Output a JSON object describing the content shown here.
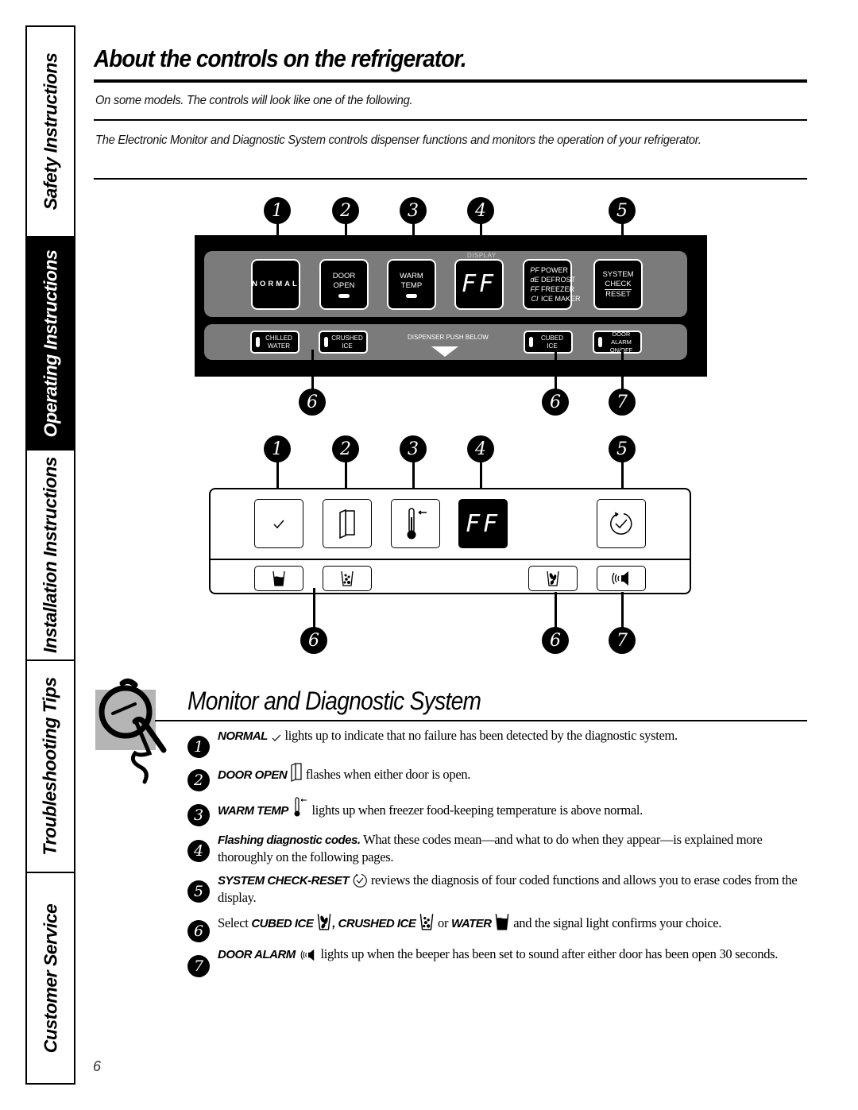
{
  "side_tabs": [
    {
      "label": "Safety Instructions",
      "active": false
    },
    {
      "label": "Operating Instructions",
      "active": true
    },
    {
      "label": "Installation Instructions",
      "active": false
    },
    {
      "label": "Troubleshooting Tips",
      "active": false
    },
    {
      "label": "Customer Service",
      "active": false
    }
  ],
  "header": {
    "title": "About the controls on the refrigerator.",
    "note": "On some models. The controls will look like one of the following.",
    "intro": "The Electronic Monitor and Diagnostic System controls dispenser functions and monitors the operation of your refrigerator."
  },
  "callouts": {
    "top": [
      "1",
      "2",
      "3",
      "4",
      "5"
    ],
    "bottom": [
      "6",
      "6",
      "7"
    ]
  },
  "panel1": {
    "normal": "NORMAL",
    "door_open": [
      "DOOR",
      "OPEN"
    ],
    "warm_temp": [
      "WARM",
      "TEMP"
    ],
    "display_label": "DISPLAY",
    "display_value": "FF",
    "codes": [
      {
        "code": "PF",
        "label": "POWER"
      },
      {
        "code": "dE",
        "label": "DEFROST"
      },
      {
        "code": "FF",
        "label": "FREEZER"
      },
      {
        "code": "CI",
        "label": "ICE MAKER"
      }
    ],
    "system_check": [
      "SYSTEM",
      "CHECK",
      "RESET"
    ],
    "chilled_water": [
      "CHILLED",
      "WATER"
    ],
    "crushed_ice": [
      "CRUSHED",
      "ICE"
    ],
    "dispenser_label": "DISPENSER PUSH BELOW",
    "cubed_ice": [
      "CUBED",
      "ICE"
    ],
    "door_alarm": [
      "DOOR ALARM",
      "ON/OFF"
    ]
  },
  "panel2": {
    "display_value": "FF",
    "icons": [
      "check-icon",
      "door-icon",
      "thermometer-icon",
      "display",
      "system-check-icon",
      "water-glass-icon",
      "crushed-ice-icon",
      "cubed-ice-icon",
      "door-alarm-icon"
    ]
  },
  "monitor": {
    "title": "Monitor and Diagnostic System",
    "items": [
      {
        "num": "1",
        "bold": "NORMAL",
        "text": "lights up to indicate that no failure has been detected by the diagnostic system."
      },
      {
        "num": "2",
        "bold": "DOOR OPEN",
        "text": "flashes when either door is open."
      },
      {
        "num": "3",
        "bold": "WARM TEMP",
        "text": "lights up when freezer food-keeping temperature is above normal."
      },
      {
        "num": "4",
        "bold": "Flashing diagnostic codes.",
        "text": "What these codes mean—and what to do when they appear—is explained more thoroughly on the following pages."
      },
      {
        "num": "5",
        "bold": "SYSTEM CHECK-RESET",
        "text": "reviews the diagnosis of four coded functions and allows you to erase codes from the display."
      },
      {
        "num": "6",
        "pre": "Select",
        "bold": "CUBED ICE",
        "bold2": ", CRUSHED ICE",
        "mid": "or",
        "bold3": "WATER",
        "text": "and the signal light confirms your choice."
      },
      {
        "num": "7",
        "bold": "DOOR ALARM",
        "text": "lights up when the beeper has been set to sound after either door has been open 30 seconds."
      }
    ]
  },
  "page_number": "6"
}
